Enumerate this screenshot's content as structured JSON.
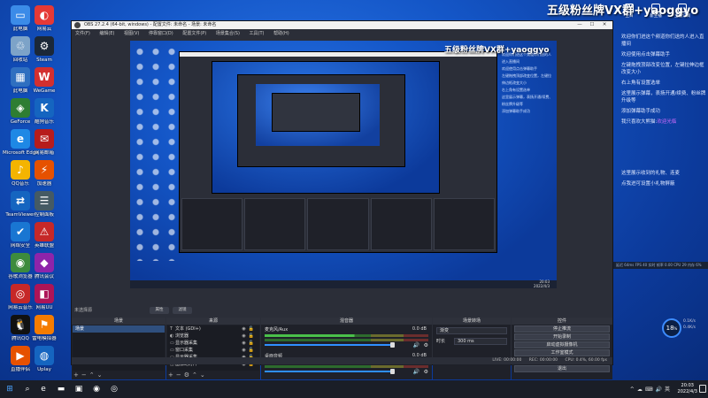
{
  "desktop_icons": [
    {
      "label": "此电脑",
      "color": "#3b8be8",
      "glyph": "▭"
    },
    {
      "label": "回收站",
      "color": "#7da3c8",
      "glyph": "♲"
    },
    {
      "label": "此电脑",
      "color": "#2f6fc0",
      "glyph": "▦"
    },
    {
      "label": "GeForce",
      "color": "#2e7d32",
      "glyph": "◈"
    },
    {
      "label": "Microsoft Edge",
      "color": "#1e88e5",
      "glyph": "e"
    },
    {
      "label": "QQ音乐",
      "color": "#f4b400",
      "glyph": "♪"
    },
    {
      "label": "TeamViewer",
      "color": "#1565c0",
      "glyph": "⇄"
    },
    {
      "label": "网络安全",
      "color": "#1976d2",
      "glyph": "✔"
    },
    {
      "label": "谷歌浏览器",
      "color": "#3d8b3d",
      "glyph": "◉"
    },
    {
      "label": "网易云音乐",
      "color": "#c62828",
      "glyph": "◎"
    },
    {
      "label": "腾讯QQ",
      "color": "#111111",
      "glyph": "🐧"
    },
    {
      "label": "直播伴侣",
      "color": "#e65100",
      "glyph": "▶"
    },
    {
      "label": "网易云",
      "color": "#e53935",
      "glyph": "◐"
    },
    {
      "label": "Steam",
      "color": "#1b2838",
      "glyph": "⚙"
    },
    {
      "label": "WeGame",
      "color": "#d32f2f",
      "glyph": "W"
    },
    {
      "label": "酷狗音乐",
      "color": "#1565c0",
      "glyph": "K"
    },
    {
      "label": "网易邮箱",
      "color": "#b71c1c",
      "glyph": "✉"
    },
    {
      "label": "加速器",
      "color": "#e65100",
      "glyph": "⚡"
    },
    {
      "label": "控制面板",
      "color": "#455a64",
      "glyph": "☰"
    },
    {
      "label": "英雄联盟",
      "color": "#c62828",
      "glyph": "⚠"
    },
    {
      "label": "腾讯会议",
      "color": "#8e24aa",
      "glyph": "◆"
    },
    {
      "label": "网易UU",
      "color": "#ad1457",
      "glyph": "◧"
    },
    {
      "label": "雷电模拟器",
      "color": "#f57c00",
      "glyph": "⚑"
    },
    {
      "label": "Uplay",
      "color": "#1565c0",
      "glyph": "◍"
    }
  ],
  "obs": {
    "title": "OBS 27.2.4 (64-bit, windows) - 配置文件: 未命名 - 场景: 未命名",
    "menu": [
      "文件(F)",
      "编辑(E)",
      "视图(V)",
      "停靠窗口(D)",
      "配置文件(P)",
      "场景集合(S)",
      "工具(T)",
      "帮助(H)"
    ],
    "watermark": "五级粉丝牌VX群+yaoggyo",
    "preview_clock": {
      "time": "20:03",
      "date": "2022/4/3"
    },
    "strip_label": "未选择源",
    "strip_buttons": [
      "属性",
      "滤镜"
    ],
    "docks": {
      "scenes": {
        "title": "场景",
        "items": [
          "场景"
        ]
      },
      "sources": {
        "title": "来源",
        "items": [
          {
            "icon": "T",
            "label": "文本 (GDI+)"
          },
          {
            "icon": "◐",
            "label": "浏览器"
          },
          {
            "icon": "▭",
            "label": "显示器采集"
          },
          {
            "icon": "▭",
            "label": "窗口采集"
          },
          {
            "icon": "▭",
            "label": "显示器采集"
          },
          {
            "icon": "◱",
            "label": "图像幻灯片"
          }
        ]
      },
      "mixer": {
        "title": "混音器",
        "channels": [
          {
            "name": "麦克风/Aux",
            "db": "0.0 dB"
          },
          {
            "name": "桌面音频",
            "db": "0.0 dB"
          }
        ]
      },
      "transitions": {
        "title": "场景转场",
        "type_label": "渐变",
        "duration_label": "时长",
        "duration_value": "300 ms"
      },
      "controls": {
        "title": "控件",
        "buttons": [
          "停止推流",
          "开始录制",
          "启动虚拟摄像机",
          "工作室模式",
          "设置",
          "退出"
        ]
      }
    },
    "statusbar": {
      "live": "LIVE: 00:00:00",
      "rec": "REC: 00:00:00",
      "cpu": "CPU: 0.4%, 60.00 fps"
    }
  },
  "right_overlay": {
    "watermark": "五级粉丝牌VX群+yaoggyo",
    "top_icons": [
      "生日",
      "新主播",
      "主播订阅"
    ],
    "chat": [
      "欢迎你们进这个频道你们送的人进入直播间",
      "欢迎使用点击弹幕助手",
      "左键拖拽顶部改变位置，左键拉伸边框改变大小",
      "右上角有设置选单",
      "这里展示弹幕，表扬开通/续费、粉丝牌升级等",
      "添加弹幕助手成功"
    ],
    "chat_hl_prefix": "我只喜欢大熊猫:",
    "chat_hl": "欢迎光临",
    "chat2": [
      "这里展示收到的礼物、连麦",
      "点我进可设置小礼物屏蔽"
    ],
    "stats": "延迟 64ms FPS 40 实时 帧率 0.00 CPU 29 内存 6%",
    "gauge": {
      "value": "18",
      "unit": "%"
    },
    "gauge_side": [
      "0.1K/s",
      "0.4K/s"
    ]
  },
  "taskbar": {
    "clock_time": "20:03",
    "clock_date": "2022/4/3",
    "tray_icons": [
      "^",
      "☁",
      "⌨",
      "🔊",
      "英"
    ]
  }
}
